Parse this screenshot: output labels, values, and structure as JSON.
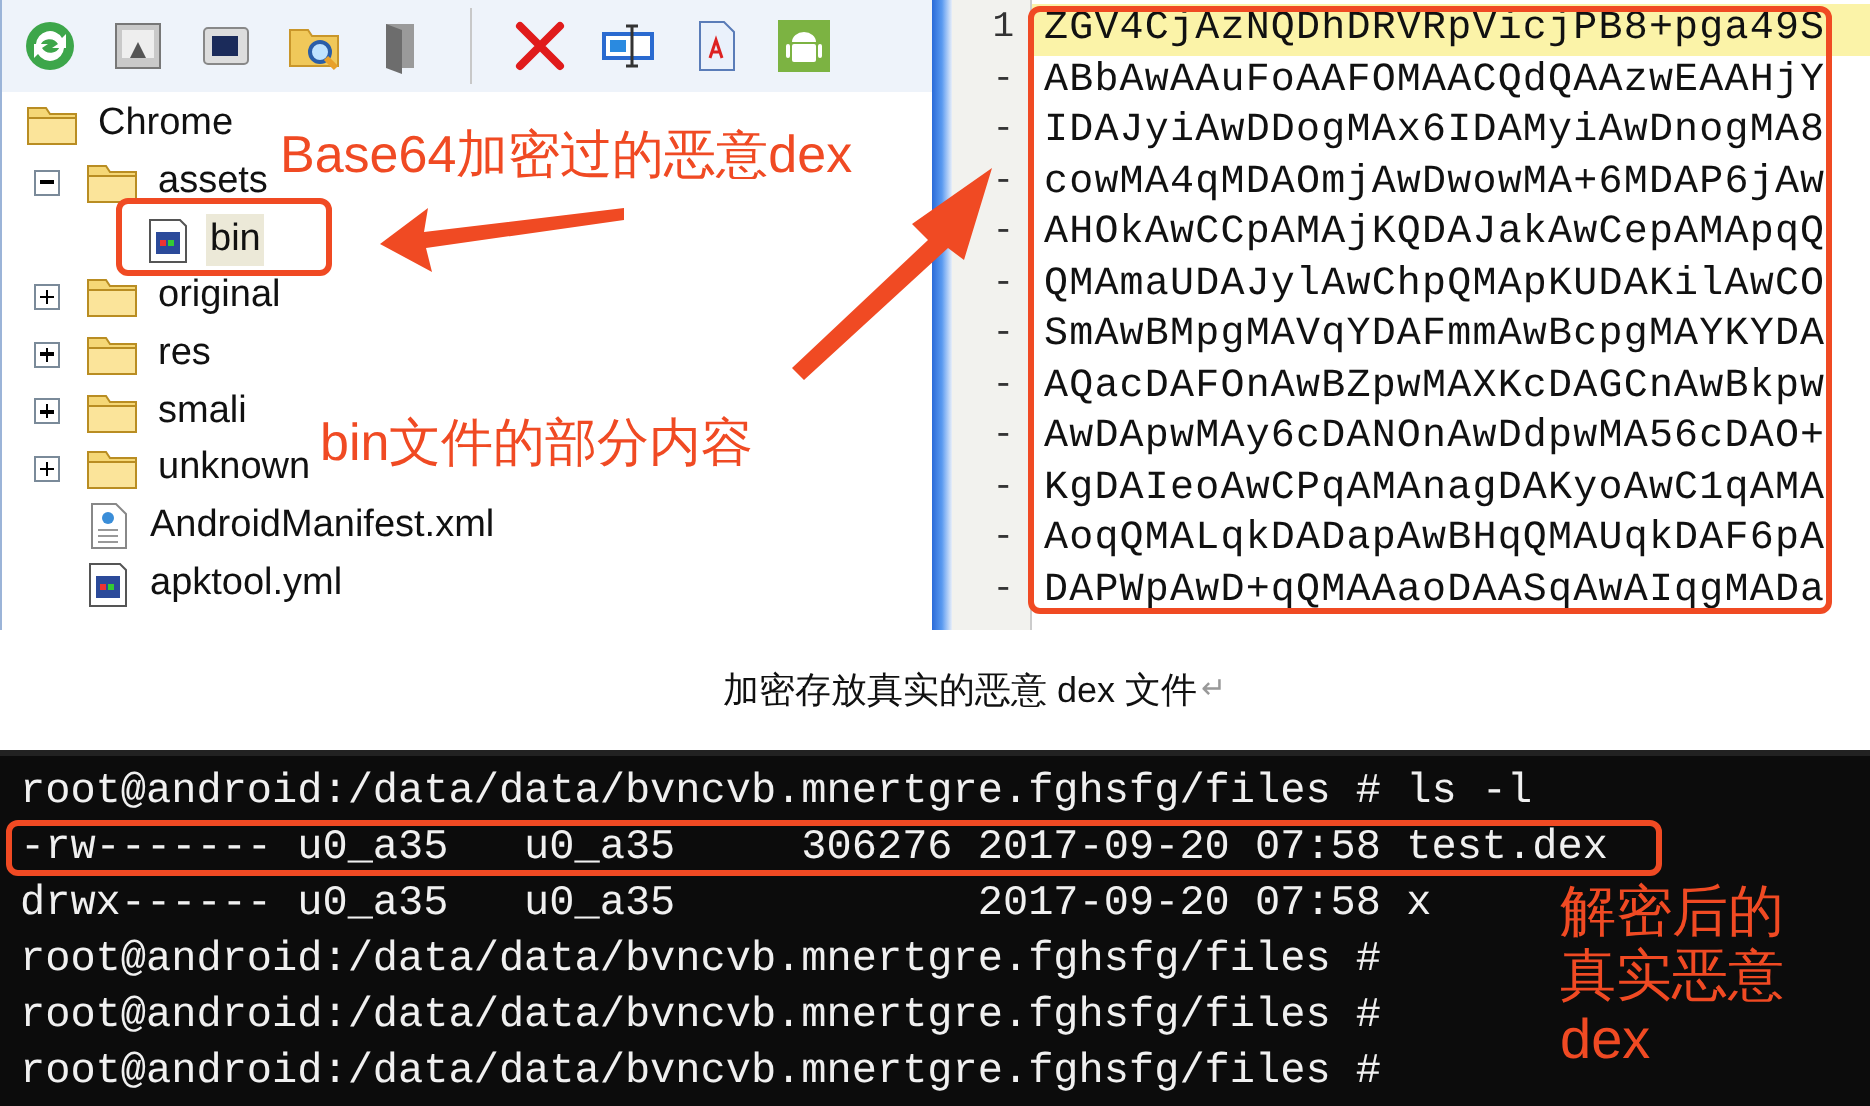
{
  "toolbar": {
    "icons": [
      {
        "kind": "refresh"
      },
      {
        "kind": "image"
      },
      {
        "kind": "monitor"
      },
      {
        "kind": "folder-search"
      },
      {
        "kind": "door"
      },
      {
        "kind": "separator"
      },
      {
        "kind": "delete"
      },
      {
        "kind": "rename"
      },
      {
        "kind": "document"
      },
      {
        "kind": "android"
      }
    ]
  },
  "file_tree": {
    "label": "Chrome",
    "children": [
      {
        "label": "assets",
        "kind": "folder",
        "expanded": true,
        "selected": false,
        "children": [
          {
            "label": "bin",
            "kind": "file",
            "selected": true
          }
        ]
      },
      {
        "label": "original",
        "kind": "folder",
        "expanded": false,
        "selected": false
      },
      {
        "label": "res",
        "kind": "folder",
        "expanded": false,
        "selected": false
      },
      {
        "label": "smali",
        "kind": "folder",
        "expanded": false,
        "selected": false
      },
      {
        "label": "unknown",
        "kind": "folder",
        "expanded": false,
        "selected": false
      },
      {
        "label": "AndroidManifest.xml",
        "kind": "xml",
        "selected": false
      },
      {
        "label": "apktool.yml",
        "kind": "file",
        "selected": false
      }
    ]
  },
  "editor": {
    "lines": [
      {
        "number": "1",
        "text": "ZGV4CjAzNQDhDRVRpVicjPB8+pga49S",
        "current": true
      },
      {
        "number": "-",
        "text": "ABbAwAAuFoAAFOMAACQdQAAzwEAAHjY",
        "current": false
      },
      {
        "number": "-",
        "text": "IDAJyiAwDDogMAx6IDAMyiAwDnogMA8",
        "current": false
      },
      {
        "number": "-",
        "text": "cowMA4qMDAOmjAwDwowMA+6MDAP6jAw",
        "current": false
      },
      {
        "number": "-",
        "text": "AHOkAwCCpAMAjKQDAJakAwCepAMApqQ",
        "current": false
      },
      {
        "number": "-",
        "text": "QMAmaUDAJylAwChpQMApKUDAKilAwCO",
        "current": false
      },
      {
        "number": "-",
        "text": "SmAwBMpgMAVqYDAFmmAwBcpgMAYKYDA",
        "current": false
      },
      {
        "number": "-",
        "text": "AQacDAFOnAwBZpwMAXKcDAGCnAwBkpw",
        "current": false
      },
      {
        "number": "-",
        "text": "AwDApwMAy6cDANOnAwDdpwMA56cDAO+",
        "current": false
      },
      {
        "number": "-",
        "text": "KgDAIeoAwCPqAMAnagDAKyoAwC1qAMA",
        "current": false
      },
      {
        "number": "-",
        "text": "AoqQMALqkDADapAwBHqQMAUqkDAF6pA",
        "current": false
      },
      {
        "number": "-",
        "text": "DAPWpAwD+qQMAAaoDAASqAwAIqgMADa",
        "current": false
      }
    ]
  },
  "annotations": [
    {
      "text": "Base64加密过的恶意dex"
    },
    {
      "text": "bin文件的部分内容"
    }
  ],
  "caption": {
    "text": "加密存放真实的恶意 dex 文件",
    "mark": "↵"
  },
  "terminal": {
    "lines": [
      {
        "text": "root@android:/data/data/bvncvb.mnertgre.fghsfg/files # ls -l",
        "highlighted": false
      },
      {
        "text": "-rw------- u0_a35   u0_a35     306276 2017-09-20 07:58 test.dex",
        "highlighted": true
      },
      {
        "text": "drwx------ u0_a35   u0_a35            2017-09-20 07:58 x",
        "highlighted": false
      },
      {
        "text": "root@android:/data/data/bvncvb.mnertgre.fghsfg/files #",
        "highlighted": false
      },
      {
        "text": "root@android:/data/data/bvncvb.mnertgre.fghsfg/files #",
        "highlighted": false
      },
      {
        "text": "root@android:/data/data/bvncvb.mnertgre.fghsfg/files #",
        "highlighted": false
      }
    ],
    "annotation": {
      "lines": [
        "解密后的",
        "真实恶意",
        "dex"
      ]
    }
  }
}
